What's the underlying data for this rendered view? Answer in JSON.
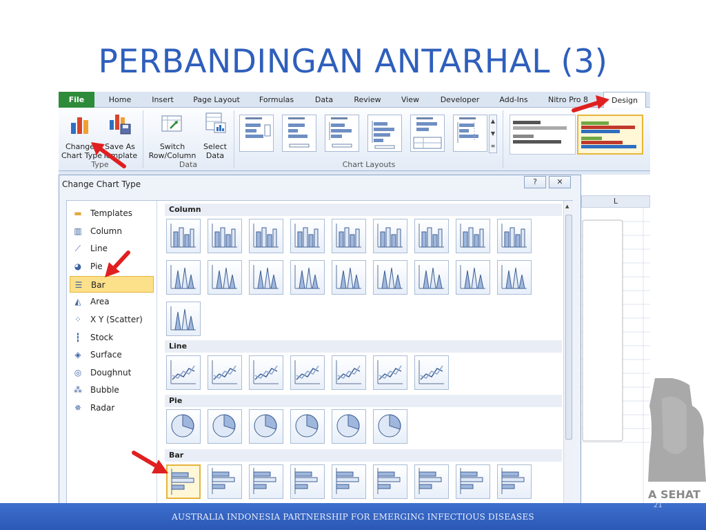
{
  "slide": {
    "title": "PERBANDINGAN ANTARHAL (3)",
    "footer": "AUSTRALIA INDONESIA PARTNERSHIP FOR EMERGING INFECTIOUS DISEASES",
    "logo_text": "A SEHAT",
    "page_number": "21"
  },
  "ribbon": {
    "tabs": [
      "File",
      "Home",
      "Insert",
      "Page Layout",
      "Formulas",
      "Data",
      "Review",
      "View",
      "Developer",
      "Add-Ins",
      "Nitro Pro 8",
      "Design"
    ],
    "active_tab": "Design",
    "change_chart_type": "Change\nChart Type",
    "save_as_template": "Save As\nTemplate",
    "group_type": "Type",
    "switch_row_column": "Switch\nRow/Column",
    "select_data": "Select\nData",
    "group_data": "Data",
    "group_chart_layouts": "Chart Layouts"
  },
  "dialog": {
    "title": "Change Chart Type",
    "help_button": "?",
    "close_button": "✕",
    "categories": [
      {
        "label": "Templates",
        "icon": "folder-icon"
      },
      {
        "label": "Column",
        "icon": "column-chart-icon"
      },
      {
        "label": "Line",
        "icon": "line-chart-icon"
      },
      {
        "label": "Pie",
        "icon": "pie-chart-icon"
      },
      {
        "label": "Bar",
        "icon": "bar-chart-icon"
      },
      {
        "label": "Area",
        "icon": "area-chart-icon"
      },
      {
        "label": "X Y (Scatter)",
        "icon": "scatter-chart-icon"
      },
      {
        "label": "Stock",
        "icon": "stock-chart-icon"
      },
      {
        "label": "Surface",
        "icon": "surface-chart-icon"
      },
      {
        "label": "Doughnut",
        "icon": "doughnut-chart-icon"
      },
      {
        "label": "Bubble",
        "icon": "bubble-chart-icon"
      },
      {
        "label": "Radar",
        "icon": "radar-chart-icon"
      }
    ],
    "selected_category": "Bar",
    "sections": {
      "column": "Column",
      "line": "Line",
      "pie": "Pie",
      "bar": "Bar"
    }
  },
  "sheet": {
    "column_header": "L"
  },
  "colors": {
    "title": "#2f5fbc",
    "file_tab": "#2e8b3a",
    "selection": "#fde08a",
    "arrow": "#e02020",
    "footer": "#2c58b6"
  }
}
